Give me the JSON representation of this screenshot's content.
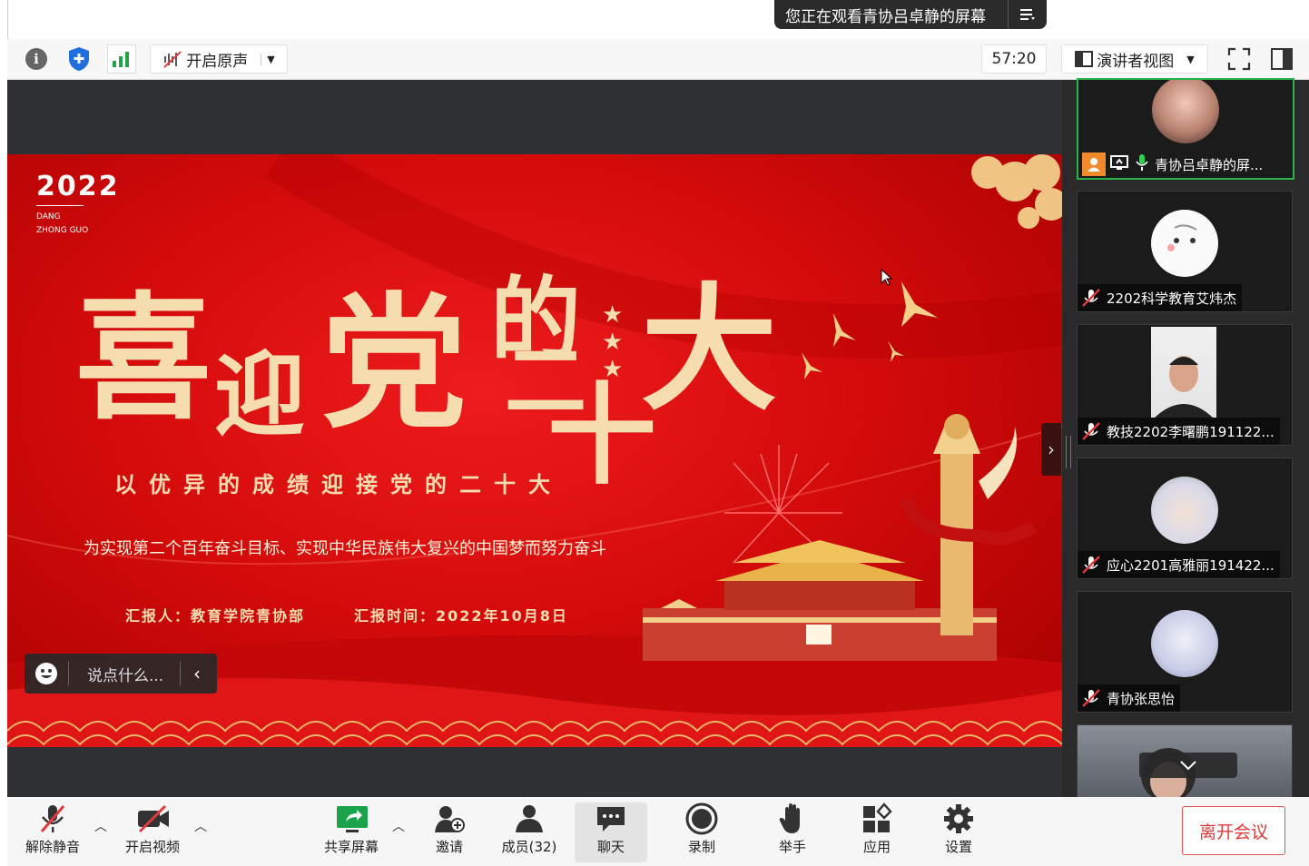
{
  "banner": {
    "text": "您正在观看青协吕卓静的屏幕"
  },
  "toolbar": {
    "original_sound": "开启原声",
    "timer": "57:20",
    "view": "演讲者视图"
  },
  "slide": {
    "year": "2022",
    "sub1": "DANG",
    "sub2": "ZHONG GUO",
    "title_chars": [
      "喜",
      "迎",
      "党",
      "的",
      "二",
      "十",
      "大"
    ],
    "subtitle": "以优异的成绩迎接党的二十大",
    "slogan": "为实现第二个百年奋斗目标、实现中华民族伟大复兴的中国梦而努力奋斗",
    "reporter": "汇报人：教育学院青协部",
    "report_time": "汇报时间：2022年10月8日"
  },
  "chat_input": {
    "placeholder": "说点什么..."
  },
  "participants": [
    {
      "name": "青协吕卓静的屏..."
    },
    {
      "name": "2202科学教育艾炜杰"
    },
    {
      "name": "教技2202李曙鹏191122..."
    },
    {
      "name": "应心2201高雅丽191422..."
    },
    {
      "name": "青协张思怡"
    }
  ],
  "bottom_bar": {
    "unmute": "解除静音",
    "start_video": "开启视频",
    "share_screen": "共享屏幕",
    "invite": "邀请",
    "members": "成员(32)",
    "chat": "聊天",
    "record": "录制",
    "raise_hand": "举手",
    "apps": "应用",
    "settings": "设置",
    "leave": "离开会议"
  },
  "colors": {
    "slide_red": "#d50b0b",
    "gold": "#f6ddb0",
    "leave_red": "#e03a3a",
    "share_green": "#1aa34a"
  }
}
